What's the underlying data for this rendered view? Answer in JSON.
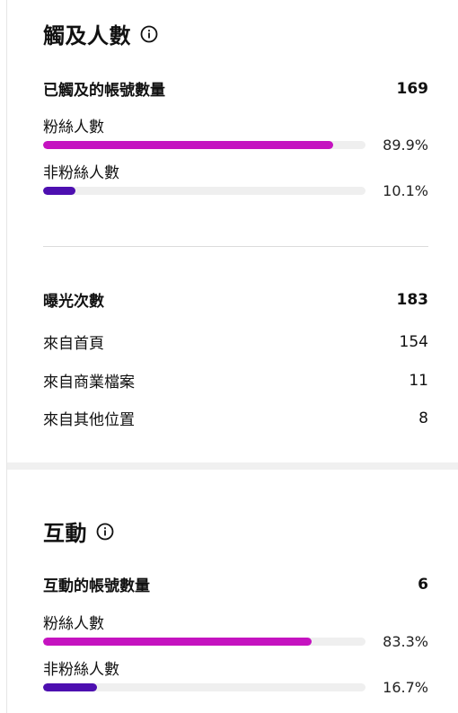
{
  "reach": {
    "title": "觸及人數",
    "accounts_label": "已觸及的帳號數量",
    "accounts_value": "169",
    "followers_label": "粉絲人數",
    "followers_pct_text": "89.9%",
    "followers_pct": 89.9,
    "nonfollowers_label": "非粉絲人數",
    "nonfollowers_pct_text": "10.1%",
    "nonfollowers_pct": 10.1,
    "impressions_label": "曝光次數",
    "impressions_value": "183",
    "sources": [
      {
        "label": "來自首頁",
        "value": "154"
      },
      {
        "label": "來自商業檔案",
        "value": "11"
      },
      {
        "label": "來自其他位置",
        "value": "8"
      }
    ]
  },
  "engagement": {
    "title": "互動",
    "accounts_label": "互動的帳號數量",
    "accounts_value": "6",
    "followers_label": "粉絲人數",
    "followers_pct_text": "83.3%",
    "followers_pct": 83.3,
    "nonfollowers_label": "非粉絲人數",
    "nonfollowers_pct_text": "16.7%",
    "nonfollowers_pct": 16.7
  },
  "icons": {
    "info": "info-circle-icon"
  },
  "colors": {
    "followers_bar": "#c513c0",
    "nonfollowers_bar": "#4d0fb0",
    "bar_track": "#efefef"
  }
}
